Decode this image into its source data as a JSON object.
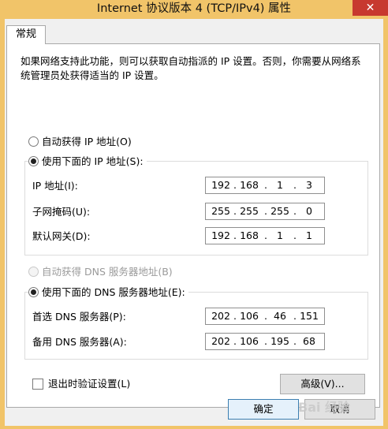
{
  "window": {
    "title": "Internet 协议版本 4 (TCP/IPv4) 属性",
    "close_label": "✕"
  },
  "tabs": [
    {
      "label": "常规"
    }
  ],
  "intro_text": "如果网络支持此功能，则可以获取自动指派的 IP 设置。否则，你需要从网络系统管理员处获得适当的 IP 设置。",
  "ip": {
    "auto_label": "自动获得 IP 地址(O)",
    "manual_label": "使用下面的 IP 地址(S):",
    "mode": "manual",
    "address_label": "IP 地址(I):",
    "address": [
      "192",
      "168",
      "1",
      "3"
    ],
    "subnet_label": "子网掩码(U):",
    "subnet": [
      "255",
      "255",
      "255",
      "0"
    ],
    "gateway_label": "默认网关(D):",
    "gateway": [
      "192",
      "168",
      "1",
      "1"
    ]
  },
  "dns": {
    "auto_label": "自动获得 DNS 服务器地址(B)",
    "manual_label": "使用下面的 DNS 服务器地址(E):",
    "mode": "manual",
    "preferred_label": "首选 DNS 服务器(P):",
    "preferred": [
      "202",
      "106",
      "46",
      "151"
    ],
    "alternate_label": "备用 DNS 服务器(A):",
    "alternate": [
      "202",
      "106",
      "195",
      "68"
    ]
  },
  "validate_label": "退出时验证设置(L)",
  "validate_checked": false,
  "advanced_label": "高级(V)...",
  "ok_label": "确定",
  "cancel_label": "取消",
  "watermark": "Bai 经验"
}
